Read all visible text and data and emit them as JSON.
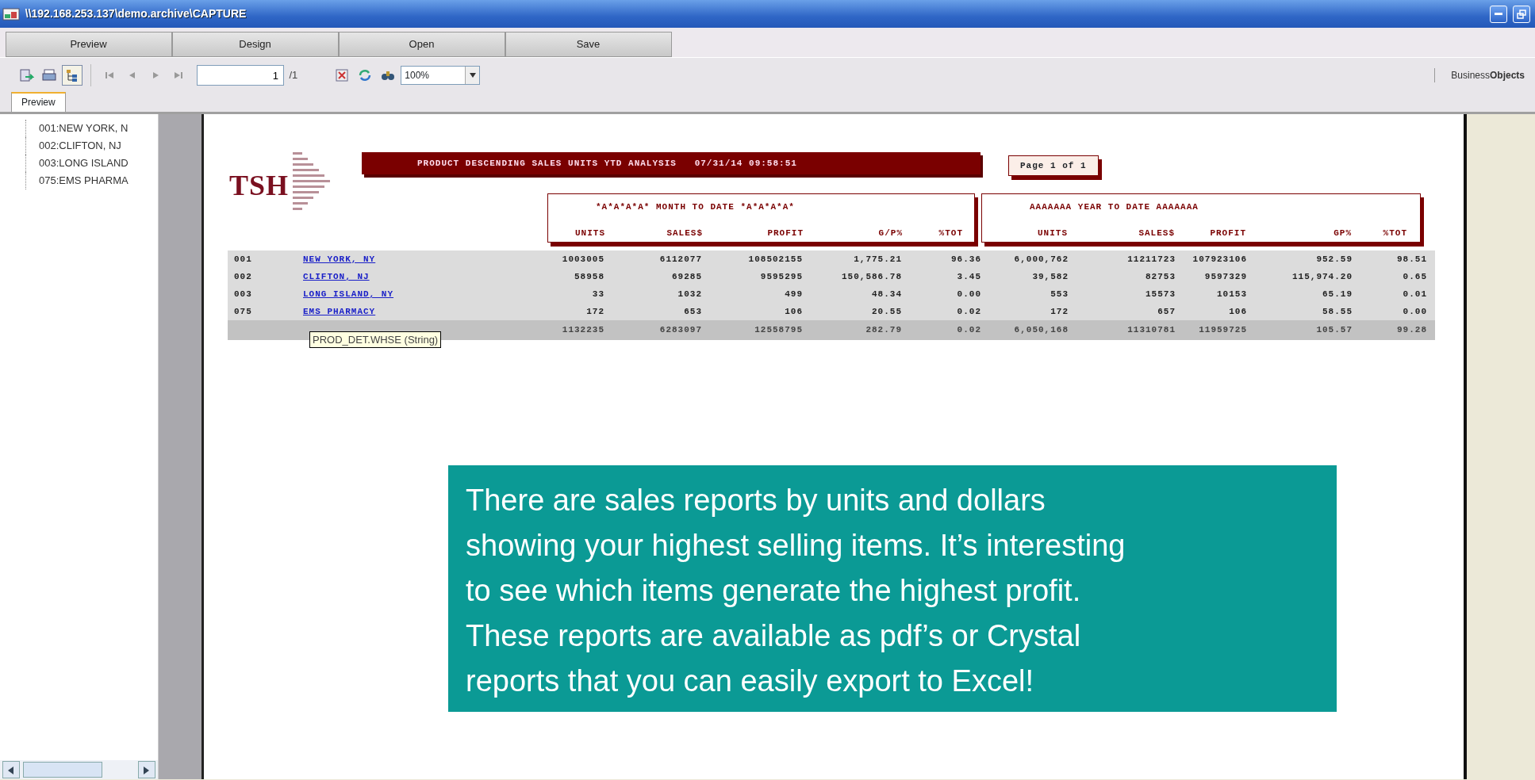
{
  "window": {
    "title": "\\\\192.168.253.137\\demo.archive\\CAPTURE"
  },
  "top_tabs": [
    {
      "label": "Preview"
    },
    {
      "label": "Design"
    },
    {
      "label": "Open"
    },
    {
      "label": "Save"
    }
  ],
  "toolbar": {
    "group_tree_shown": true,
    "page_input": "1",
    "page_total": "/1",
    "zoom": "100%",
    "brand": "Business**Objects**"
  },
  "view_tabs": [
    {
      "label": "Preview",
      "selected": true
    }
  ],
  "tree_items": [
    {
      "label": "001:NEW YORK, N"
    },
    {
      "label": "002:CLIFTON, NJ"
    },
    {
      "label": "003:LONG ISLAND"
    },
    {
      "label": "075:EMS PHARMA"
    }
  ],
  "report": {
    "logo_text": "TSH",
    "title": "PRODUCT DESCENDING SALES UNITS YTD ANALYSIS   07/31/14 09:58:51",
    "page_label": "Page 1 of 1",
    "bands": [
      {
        "title": "*A*A*A*A* MONTH TO DATE *A*A*A*A*",
        "columns": [
          "UNITS",
          "SALES$",
          "PROFIT",
          "G/P%",
          "%TOT"
        ]
      },
      {
        "title": "AAAAAAA YEAR TO DATE AAAAAAA",
        "columns": [
          "UNITS",
          "SALES$",
          "PROFIT",
          "GP%",
          "%TOT"
        ]
      }
    ],
    "rows": [
      {
        "code": "001",
        "name": "NEW YORK, NY",
        "values": [
          "1003005",
          "6112077",
          "108502155",
          "1,775.21",
          "96.36",
          "6,000,762",
          "11211723",
          "107923106",
          "952.59",
          "98.51"
        ]
      },
      {
        "code": "002",
        "name": "CLIFTON, NJ",
        "values": [
          "58958",
          "69285",
          "9595295",
          "150,586.78",
          "3.45",
          "39,582",
          "82753",
          "9597329",
          "115,974.20",
          "0.65"
        ]
      },
      {
        "code": "003",
        "name": "LONG ISLAND, NY",
        "values": [
          "33",
          "1032",
          "499",
          "48.34",
          "0.00",
          "553",
          "15573",
          "10153",
          "65.19",
          "0.01"
        ]
      },
      {
        "code": "075",
        "name": "EMS PHARMACY",
        "values": [
          "172",
          "653",
          "106",
          "20.55",
          "0.02",
          "172",
          "657",
          "106",
          "58.55",
          "0.00"
        ]
      }
    ],
    "total": {
      "values": [
        "1132235",
        "6283097",
        "12558795",
        "282.79",
        "0.02",
        "6,050,168",
        "11310781",
        "11959725",
        "105.57",
        "99.28"
      ]
    },
    "tooltip": "PROD_DET.WHSE (String)"
  },
  "callout": {
    "lines": [
      "There are sales reports by units and dollars",
      "showing your highest selling items.  It’s interesting",
      "to see which items generate the highest profit.",
      "These reports are available as pdf’s or Crystal",
      "reports that you can easily export  to Excel!"
    ]
  }
}
